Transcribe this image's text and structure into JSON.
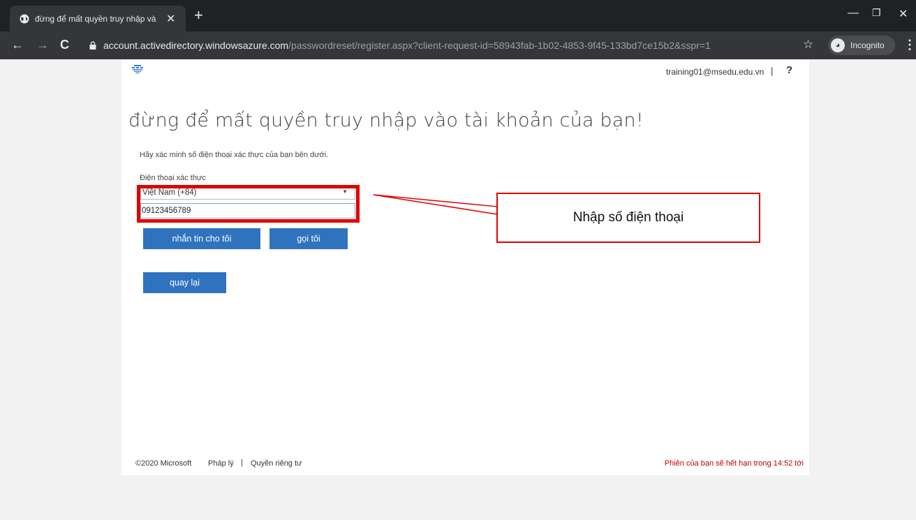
{
  "browser": {
    "tab_title": "đừng để mất quyền truy nhập và",
    "url_host": "account.activedirectory.windowsazure.com",
    "url_path": "/passwordreset/register.aspx?client-request-id=58943fab-1b02-4853-9f45-133bd7ce15b2&sspr=1",
    "incognito_label": "Incognito"
  },
  "header": {
    "account_email": "training01@msedu.edu.vn",
    "separator": "|",
    "help": "?"
  },
  "main": {
    "title": "đừng để mất quyền truy nhập vào tài khoản của bạn!",
    "instruction": "Hãy xác minh số điện thoại xác thực của bạn bên dưới.",
    "phone_label": "Điện thoại xác thực",
    "country_value": "Việt Nam (+84)",
    "phone_value": "09123456789",
    "text_me_button": "nhắn tin cho tôi",
    "call_me_button": "gọi tôi",
    "back_button": "quay lại"
  },
  "annotation": {
    "callout_text": "Nhập số điện thoại",
    "color": "#e00000"
  },
  "footer": {
    "copyright": "©2020 Microsoft",
    "legal": "Pháp lý",
    "separator": "|",
    "privacy": "Quyền riêng tư",
    "session_notice": "Phiên của bạn sẽ hết hạn trong 14:52 tới"
  },
  "colors": {
    "button_blue": "#2f73bf",
    "chrome_dark": "#202124",
    "session_red": "#c00000"
  }
}
